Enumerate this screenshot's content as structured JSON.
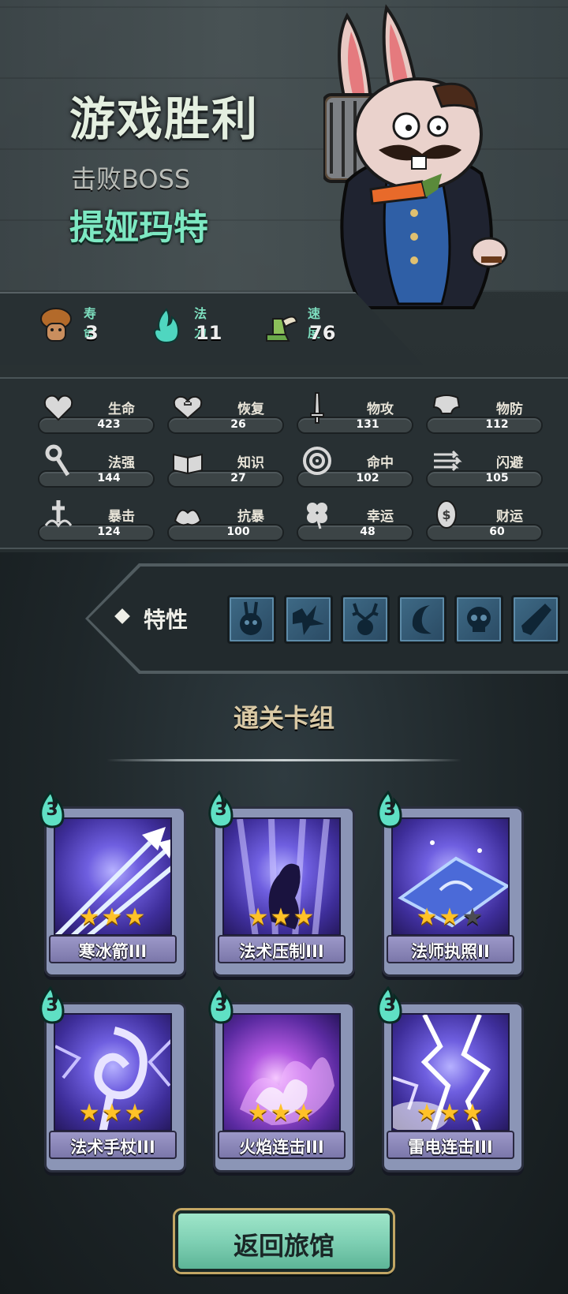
{
  "result": {
    "title": "游戏胜利",
    "subtitle": "击败BOSS",
    "boss_name": "提娅玛特"
  },
  "summary": [
    {
      "label": "寿命",
      "value": "3",
      "icon": "mushroom-hero-icon"
    },
    {
      "label": "法力",
      "value": "11",
      "icon": "mana-flame-icon"
    },
    {
      "label": "速度",
      "value": "76",
      "icon": "winged-boot-icon"
    }
  ],
  "stats": [
    {
      "label": "生命",
      "value": "423",
      "icon": "heart-icon"
    },
    {
      "label": "恢复",
      "value": "26",
      "icon": "heal-heart-icon"
    },
    {
      "label": "物攻",
      "value": "131",
      "icon": "sword-icon"
    },
    {
      "label": "物防",
      "value": "112",
      "icon": "armor-icon"
    },
    {
      "label": "法强",
      "value": "144",
      "icon": "staff-icon"
    },
    {
      "label": "知识",
      "value": "27",
      "icon": "book-icon"
    },
    {
      "label": "命中",
      "value": "102",
      "icon": "target-icon"
    },
    {
      "label": "闪避",
      "value": "105",
      "icon": "dodge-arrows-icon"
    },
    {
      "label": "暴击",
      "value": "124",
      "icon": "crit-icon"
    },
    {
      "label": "抗暴",
      "value": "100",
      "icon": "crit-resist-icon"
    },
    {
      "label": "幸运",
      "value": "48",
      "icon": "clover-icon"
    },
    {
      "label": "财运",
      "value": "60",
      "icon": "coin-icon"
    }
  ],
  "traits": {
    "label": "特性",
    "items": [
      "rabbit-trait-icon",
      "shatter-trait-icon",
      "antler-trait-icon",
      "moon-trait-icon",
      "skull-trait-icon",
      "crystal-trait-icon"
    ]
  },
  "deck": {
    "title": "通关卡组",
    "cards": [
      {
        "name": "寒冰箭III",
        "cost": "3",
        "stars": 3,
        "max_stars": 3,
        "art": "ice-arrows"
      },
      {
        "name": "法术压制III",
        "cost": "3",
        "stars": 3,
        "max_stars": 3,
        "art": "spell-suppress"
      },
      {
        "name": "法师执照II",
        "cost": "3",
        "stars": 2,
        "max_stars": 3,
        "art": "mage-license"
      },
      {
        "name": "法术手杖III",
        "cost": "3",
        "stars": 3,
        "max_stars": 3,
        "art": "spell-staff"
      },
      {
        "name": "火焰连击III",
        "cost": "3",
        "stars": 3,
        "max_stars": 3,
        "art": "flame-combo"
      },
      {
        "name": "雷电连击III",
        "cost": "3",
        "stars": 3,
        "max_stars": 3,
        "art": "thunder-combo"
      }
    ]
  },
  "return_button": "返回旅馆",
  "colors": {
    "accent": "#7de8c2",
    "star": "#ffc228",
    "card_art": "#6f5fe0"
  }
}
